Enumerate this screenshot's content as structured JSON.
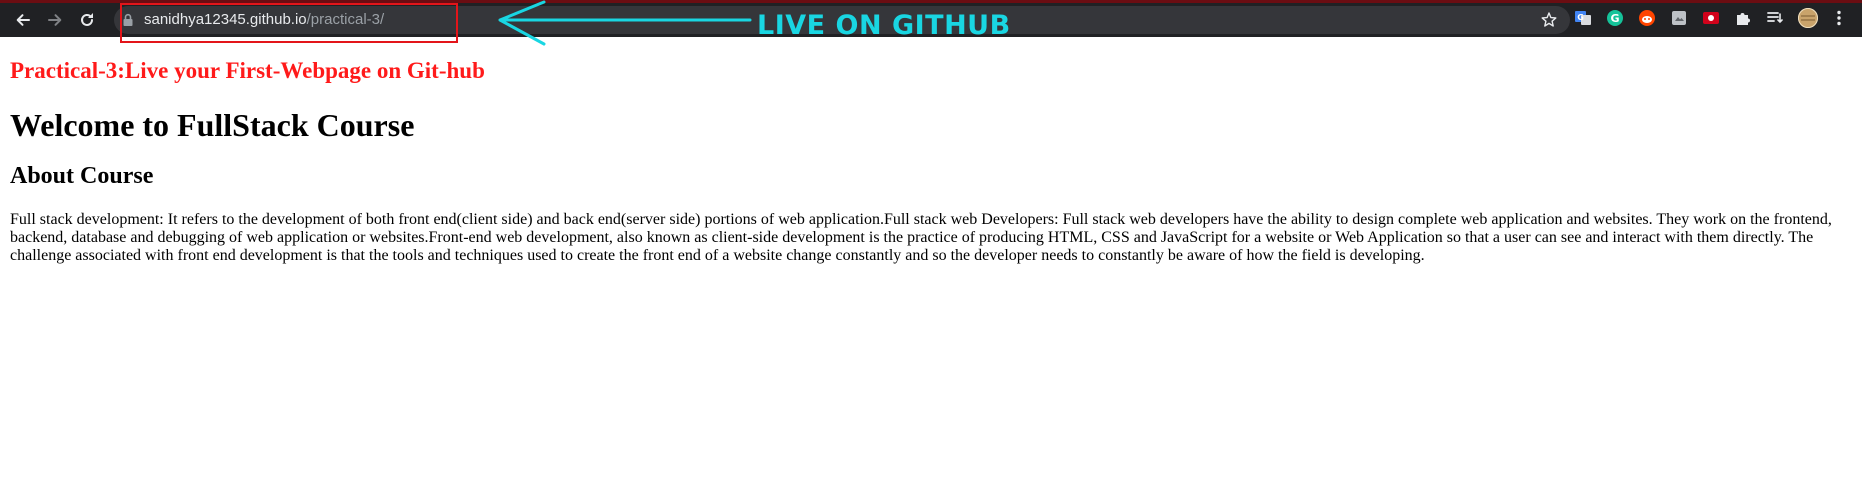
{
  "browser": {
    "url_host": "sanidhya12345.github.io",
    "url_path": "/practical-3/",
    "nav_icons": [
      "back-icon",
      "forward-icon",
      "reload-icon"
    ],
    "extension_icons": [
      "translate-icon",
      "grammarly-icon",
      "reddit-icon",
      "screenshot-icon",
      "recorder-icon",
      "puzzle-icon",
      "reading-list-icon",
      "profile-avatar",
      "menu-icon"
    ],
    "theme_colors": {
      "toolbar": "#202124",
      "omnibox": "#35363a",
      "accent_stripe": "#6b0d12"
    }
  },
  "annotation": {
    "label": "LIVE ON GITHUB",
    "label_color": "#19d6e2",
    "box_color": "#e3151a"
  },
  "page": {
    "practical_heading": "Practical-3:Live your First-Webpage on Git-hub",
    "practical_heading_color": "#ff1a1a",
    "title": "Welcome to FullStack Course",
    "subtitle": "About Course",
    "description": "Full stack development: It refers to the development of both front end(client side) and back end(server side) portions of web application.Full stack web Developers: Full stack web developers have the ability to design complete web application and websites. They work on the frontend, backend, database and debugging of web application or websites.Front-end web development, also known as client-side development is the practice of producing HTML, CSS and JavaScript for a website or Web Application so that a user can see and interact with them directly. The challenge associated with front end development is that the tools and techniques used to create the front end of a website change constantly and so the developer needs to constantly be aware of how the field is developing."
  }
}
